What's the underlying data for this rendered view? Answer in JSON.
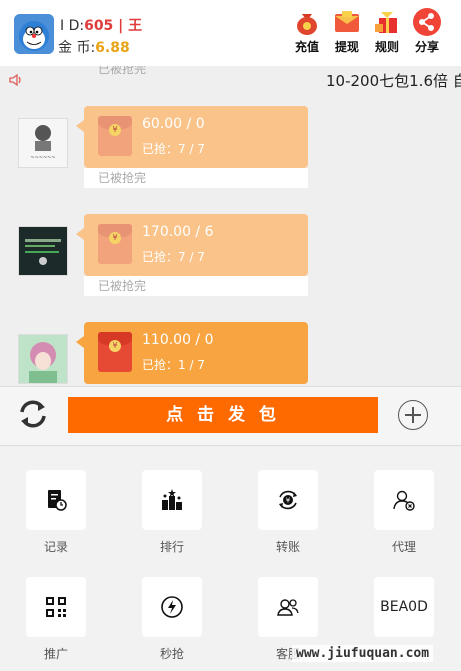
{
  "header": {
    "id_label": "I D:",
    "id_value": "605 | 王",
    "coin_label": "金 币:",
    "coin_value": "6.88",
    "buttons": [
      {
        "label": "充值",
        "icon": "money-bag-icon",
        "color": "#e0462e"
      },
      {
        "label": "提现",
        "icon": "red-envelope-icon",
        "color": "#f05a3a"
      },
      {
        "label": "规则",
        "icon": "gift-icon",
        "color": "#e8312f"
      },
      {
        "label": "分享",
        "icon": "share-icon",
        "color": "#f04437"
      }
    ]
  },
  "marquee": {
    "text": "10-200七包1.6倍 自",
    "ghost": "已被抢完"
  },
  "messages": [
    {
      "amount": "60.00 / 0",
      "grabbed": "已抢：7 / 7",
      "status": "已被抢完",
      "bubble_color": "#fac38a",
      "env_color": "#f2a37c"
    },
    {
      "amount": "170.00 / 6",
      "grabbed": "已抢：7 / 7",
      "status": "已被抢完",
      "bubble_color": "#fac38a",
      "env_color": "#f2a37c"
    },
    {
      "amount": "110.00 / 0",
      "grabbed": "已抢：1 / 7",
      "status": "",
      "bubble_color": "#f7a441",
      "env_color": "#e64a35"
    }
  ],
  "sendbar": {
    "send_label": "点 击 发 包"
  },
  "menu": {
    "items": [
      {
        "label": "记录",
        "icon": "record-icon"
      },
      {
        "label": "排行",
        "icon": "ranking-icon"
      },
      {
        "label": "转账",
        "icon": "transfer-icon"
      },
      {
        "label": "代理",
        "icon": "agent-icon"
      },
      {
        "label": "推广",
        "icon": "qrcode-icon"
      },
      {
        "label": "秒抢",
        "icon": "lightning-icon"
      },
      {
        "label": "客服",
        "icon": "customer-service-icon"
      },
      {
        "label": "BEA0D",
        "icon": ""
      }
    ]
  },
  "watermark": "www.jiufuquan.com"
}
